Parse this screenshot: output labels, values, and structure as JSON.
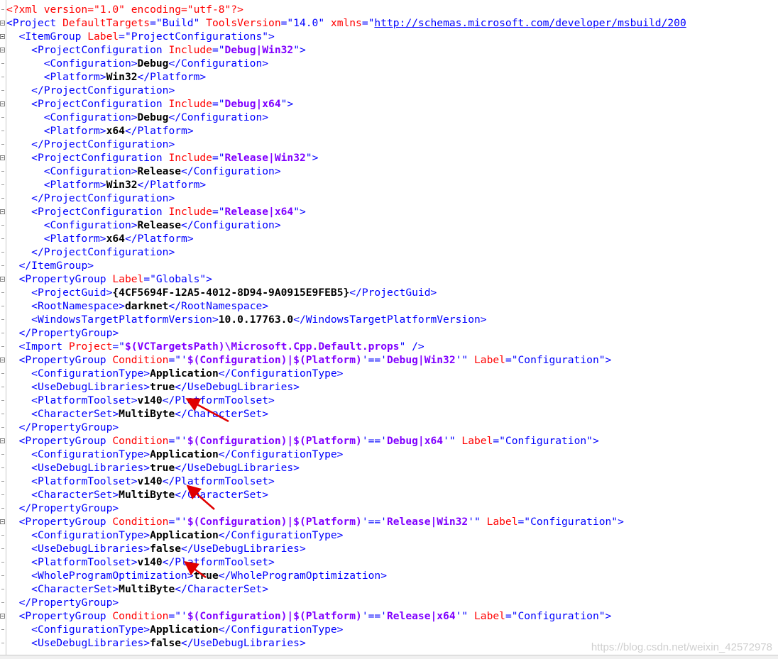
{
  "editor": {
    "lines": [
      [
        [
          "pi",
          "<?xml version=\"1.0\" encoding=\"utf-8\"?>"
        ]
      ],
      [
        [
          "t",
          "<Project "
        ],
        [
          "a",
          "DefaultTargets"
        ],
        [
          "t",
          "=\"Build\" "
        ],
        [
          "a",
          "ToolsVersion"
        ],
        [
          "t",
          "=\"14.0\" "
        ],
        [
          "a",
          "xmlns"
        ],
        [
          "t",
          "=\""
        ],
        [
          "u",
          "http://schemas.microsoft.com/developer/msbuild/200"
        ]
      ],
      [
        [
          "plain",
          "  "
        ],
        [
          "t",
          "<ItemGroup "
        ],
        [
          "a",
          "Label"
        ],
        [
          "t",
          "=\"ProjectConfigurations\">"
        ]
      ],
      [
        [
          "plain",
          "    "
        ],
        [
          "t",
          "<ProjectConfiguration "
        ],
        [
          "a",
          "Include"
        ],
        [
          "t",
          "=\""
        ],
        [
          "v",
          "Debug|Win32"
        ],
        [
          "t",
          "\">"
        ]
      ],
      [
        [
          "plain",
          "      "
        ],
        [
          "t",
          "<Configuration>"
        ],
        [
          "x",
          "Debug"
        ],
        [
          "t",
          "</Configuration>"
        ]
      ],
      [
        [
          "plain",
          "      "
        ],
        [
          "t",
          "<Platform>"
        ],
        [
          "x",
          "Win32"
        ],
        [
          "t",
          "</Platform>"
        ]
      ],
      [
        [
          "plain",
          "    "
        ],
        [
          "t",
          "</ProjectConfiguration>"
        ]
      ],
      [
        [
          "plain",
          "    "
        ],
        [
          "t",
          "<ProjectConfiguration "
        ],
        [
          "a",
          "Include"
        ],
        [
          "t",
          "=\""
        ],
        [
          "v",
          "Debug|x64"
        ],
        [
          "t",
          "\">"
        ]
      ],
      [
        [
          "plain",
          "      "
        ],
        [
          "t",
          "<Configuration>"
        ],
        [
          "x",
          "Debug"
        ],
        [
          "t",
          "</Configuration>"
        ]
      ],
      [
        [
          "plain",
          "      "
        ],
        [
          "t",
          "<Platform>"
        ],
        [
          "x",
          "x64"
        ],
        [
          "t",
          "</Platform>"
        ]
      ],
      [
        [
          "plain",
          "    "
        ],
        [
          "t",
          "</ProjectConfiguration>"
        ]
      ],
      [
        [
          "plain",
          "    "
        ],
        [
          "t",
          "<ProjectConfiguration "
        ],
        [
          "a",
          "Include"
        ],
        [
          "t",
          "=\""
        ],
        [
          "v",
          "Release|Win32"
        ],
        [
          "t",
          "\">"
        ]
      ],
      [
        [
          "plain",
          "      "
        ],
        [
          "t",
          "<Configuration>"
        ],
        [
          "x",
          "Release"
        ],
        [
          "t",
          "</Configuration>"
        ]
      ],
      [
        [
          "plain",
          "      "
        ],
        [
          "t",
          "<Platform>"
        ],
        [
          "x",
          "Win32"
        ],
        [
          "t",
          "</Platform>"
        ]
      ],
      [
        [
          "plain",
          "    "
        ],
        [
          "t",
          "</ProjectConfiguration>"
        ]
      ],
      [
        [
          "plain",
          "    "
        ],
        [
          "t",
          "<ProjectConfiguration "
        ],
        [
          "a",
          "Include"
        ],
        [
          "t",
          "=\""
        ],
        [
          "v",
          "Release|x64"
        ],
        [
          "t",
          "\">"
        ]
      ],
      [
        [
          "plain",
          "      "
        ],
        [
          "t",
          "<Configuration>"
        ],
        [
          "x",
          "Release"
        ],
        [
          "t",
          "</Configuration>"
        ]
      ],
      [
        [
          "plain",
          "      "
        ],
        [
          "t",
          "<Platform>"
        ],
        [
          "x",
          "x64"
        ],
        [
          "t",
          "</Platform>"
        ]
      ],
      [
        [
          "plain",
          "    "
        ],
        [
          "t",
          "</ProjectConfiguration>"
        ]
      ],
      [
        [
          "plain",
          "  "
        ],
        [
          "t",
          "</ItemGroup>"
        ]
      ],
      [
        [
          "plain",
          "  "
        ],
        [
          "t",
          "<PropertyGroup "
        ],
        [
          "a",
          "Label"
        ],
        [
          "t",
          "=\"Globals\">"
        ]
      ],
      [
        [
          "plain",
          "    "
        ],
        [
          "t",
          "<ProjectGuid>"
        ],
        [
          "x",
          "{4CF5694F-12A5-4012-8D94-9A0915E9FEB5}"
        ],
        [
          "t",
          "</ProjectGuid>"
        ]
      ],
      [
        [
          "plain",
          "    "
        ],
        [
          "t",
          "<RootNamespace>"
        ],
        [
          "x",
          "darknet"
        ],
        [
          "t",
          "</RootNamespace>"
        ]
      ],
      [
        [
          "plain",
          "    "
        ],
        [
          "t",
          "<WindowsTargetPlatformVersion>"
        ],
        [
          "x",
          "10.0.17763.0"
        ],
        [
          "t",
          "</WindowsTargetPlatformVersion>"
        ]
      ],
      [
        [
          "plain",
          "  "
        ],
        [
          "t",
          "</PropertyGroup>"
        ]
      ],
      [
        [
          "plain",
          "  "
        ],
        [
          "t",
          "<Import "
        ],
        [
          "a",
          "Project"
        ],
        [
          "t",
          "=\""
        ],
        [
          "v",
          "$(VCTargetsPath)\\Microsoft.Cpp.Default.props"
        ],
        [
          "t",
          "\" />"
        ]
      ],
      [
        [
          "plain",
          "  "
        ],
        [
          "t",
          "<PropertyGroup "
        ],
        [
          "a",
          "Condition"
        ],
        [
          "t",
          "=\"'"
        ],
        [
          "v",
          "$(Configuration)|$(Platform)"
        ],
        [
          "t",
          "'=='"
        ],
        [
          "v",
          "Debug|Win32"
        ],
        [
          "t",
          "'\" "
        ],
        [
          "a",
          "Label"
        ],
        [
          "t",
          "=\"Configuration\">"
        ]
      ],
      [
        [
          "plain",
          "    "
        ],
        [
          "t",
          "<ConfigurationType>"
        ],
        [
          "x",
          "Application"
        ],
        [
          "t",
          "</ConfigurationType>"
        ]
      ],
      [
        [
          "plain",
          "    "
        ],
        [
          "t",
          "<UseDebugLibraries>"
        ],
        [
          "x",
          "true"
        ],
        [
          "t",
          "</UseDebugLibraries>"
        ]
      ],
      [
        [
          "plain",
          "    "
        ],
        [
          "t",
          "<PlatformToolset>"
        ],
        [
          "x",
          "v140"
        ],
        [
          "t",
          "</PlatformToolset>"
        ]
      ],
      [
        [
          "plain",
          "    "
        ],
        [
          "t",
          "<CharacterSet>"
        ],
        [
          "x",
          "MultiByte"
        ],
        [
          "t",
          "</CharacterSet>"
        ]
      ],
      [
        [
          "plain",
          "  "
        ],
        [
          "t",
          "</PropertyGroup>"
        ]
      ],
      [
        [
          "plain",
          "  "
        ],
        [
          "t",
          "<PropertyGroup "
        ],
        [
          "a",
          "Condition"
        ],
        [
          "t",
          "=\"'"
        ],
        [
          "v",
          "$(Configuration)|$(Platform)"
        ],
        [
          "t",
          "'=='"
        ],
        [
          "v",
          "Debug|x64"
        ],
        [
          "t",
          "'\" "
        ],
        [
          "a",
          "Label"
        ],
        [
          "t",
          "=\"Configuration\">"
        ]
      ],
      [
        [
          "plain",
          "    "
        ],
        [
          "t",
          "<ConfigurationType>"
        ],
        [
          "x",
          "Application"
        ],
        [
          "t",
          "</ConfigurationType>"
        ]
      ],
      [
        [
          "plain",
          "    "
        ],
        [
          "t",
          "<UseDebugLibraries>"
        ],
        [
          "x",
          "true"
        ],
        [
          "t",
          "</UseDebugLibraries>"
        ]
      ],
      [
        [
          "plain",
          "    "
        ],
        [
          "t",
          "<PlatformToolset>"
        ],
        [
          "x",
          "v140"
        ],
        [
          "t",
          "</PlatformToolset>"
        ]
      ],
      [
        [
          "plain",
          "    "
        ],
        [
          "t",
          "<CharacterSet>"
        ],
        [
          "x",
          "MultiByte"
        ],
        [
          "t",
          "</CharacterSet>"
        ]
      ],
      [
        [
          "plain",
          "  "
        ],
        [
          "t",
          "</PropertyGroup>"
        ]
      ],
      [
        [
          "plain",
          "  "
        ],
        [
          "t",
          "<PropertyGroup "
        ],
        [
          "a",
          "Condition"
        ],
        [
          "t",
          "=\"'"
        ],
        [
          "v",
          "$(Configuration)|$(Platform)"
        ],
        [
          "t",
          "'=='"
        ],
        [
          "v",
          "Release|Win32"
        ],
        [
          "t",
          "'\" "
        ],
        [
          "a",
          "Label"
        ],
        [
          "t",
          "=\"Configuration\">"
        ]
      ],
      [
        [
          "plain",
          "    "
        ],
        [
          "t",
          "<ConfigurationType>"
        ],
        [
          "x",
          "Application"
        ],
        [
          "t",
          "</ConfigurationType>"
        ]
      ],
      [
        [
          "plain",
          "    "
        ],
        [
          "t",
          "<UseDebugLibraries>"
        ],
        [
          "x",
          "false"
        ],
        [
          "t",
          "</UseDebugLibraries>"
        ]
      ],
      [
        [
          "plain",
          "    "
        ],
        [
          "t",
          "<PlatformToolset>"
        ],
        [
          "x",
          "v140"
        ],
        [
          "t",
          "</PlatformToolset>"
        ]
      ],
      [
        [
          "plain",
          "    "
        ],
        [
          "t",
          "<WholeProgramOptimization>"
        ],
        [
          "x",
          "true"
        ],
        [
          "t",
          "</WholeProgramOptimization>"
        ]
      ],
      [
        [
          "plain",
          "    "
        ],
        [
          "t",
          "<CharacterSet>"
        ],
        [
          "x",
          "MultiByte"
        ],
        [
          "t",
          "</CharacterSet>"
        ]
      ],
      [
        [
          "plain",
          "  "
        ],
        [
          "t",
          "</PropertyGroup>"
        ]
      ],
      [
        [
          "plain",
          "  "
        ],
        [
          "t",
          "<PropertyGroup "
        ],
        [
          "a",
          "Condition"
        ],
        [
          "t",
          "=\"'"
        ],
        [
          "v",
          "$(Configuration)|$(Platform)"
        ],
        [
          "t",
          "'=='"
        ],
        [
          "v",
          "Release|x64"
        ],
        [
          "t",
          "'\" "
        ],
        [
          "a",
          "Label"
        ],
        [
          "t",
          "=\"Configuration\">"
        ]
      ],
      [
        [
          "plain",
          "    "
        ],
        [
          "t",
          "<ConfigurationType>"
        ],
        [
          "x",
          "Application"
        ],
        [
          "t",
          "</ConfigurationType>"
        ]
      ],
      [
        [
          "plain",
          "    "
        ],
        [
          "t",
          "<UseDebugLibraries>"
        ],
        [
          "x",
          "false"
        ],
        [
          "t",
          "</UseDebugLibraries>"
        ]
      ]
    ],
    "fold_lines": [
      1,
      2,
      3,
      7,
      11,
      15,
      20,
      26,
      32,
      38,
      45
    ]
  },
  "watermark": "https://blog.csdn.net/weixin_42572978",
  "colors": {
    "tag": "#0000ff",
    "attribute": "#ff0000",
    "attribute_value": "#8000ff",
    "text": "#000000",
    "arrow": "#e00000"
  }
}
